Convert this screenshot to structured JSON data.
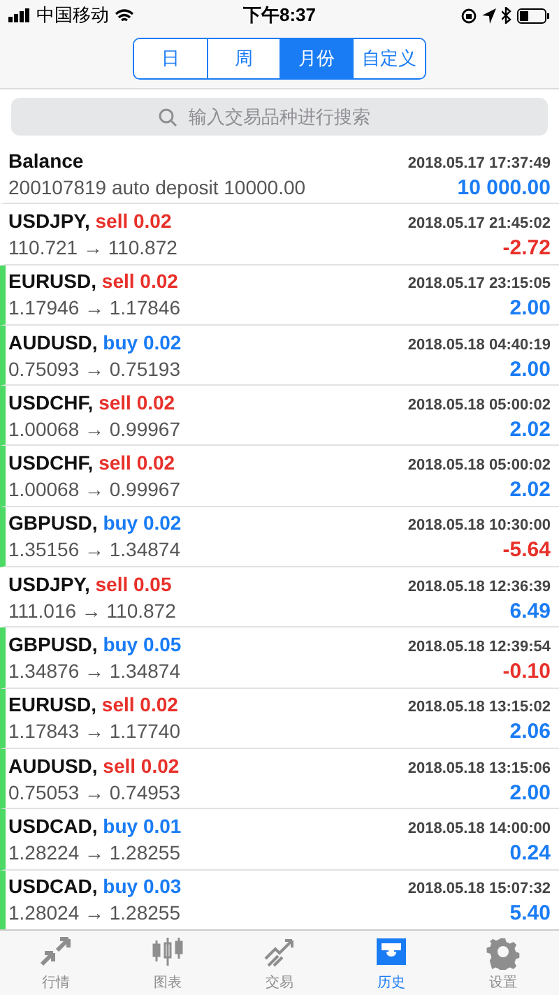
{
  "status_bar": {
    "carrier": "中国移动",
    "time": "下午8:37"
  },
  "period_tabs": [
    {
      "label": "日",
      "selected": false
    },
    {
      "label": "周",
      "selected": false
    },
    {
      "label": "月份",
      "selected": true
    },
    {
      "label": "自定义",
      "selected": false
    }
  ],
  "search": {
    "placeholder": "输入交易品种进行搜索"
  },
  "balance": {
    "title": "Balance",
    "time": "2018.05.17 17:37:49",
    "comment": "200107819 auto deposit 10000.00",
    "amount": "10 000.00"
  },
  "deals": [
    {
      "symbol": "USDJPY,",
      "side": "sell",
      "volume": "0.02",
      "time": "2018.05.17 21:45:02",
      "prices": "110.721 → 110.872",
      "profit": "-2.72",
      "loss": true,
      "marked": false
    },
    {
      "symbol": "EURUSD,",
      "side": "sell",
      "volume": "0.02",
      "time": "2018.05.17 23:15:05",
      "prices": "1.17946 → 1.17846",
      "profit": "2.00",
      "loss": false,
      "marked": true
    },
    {
      "symbol": "AUDUSD,",
      "side": "buy",
      "volume": "0.02",
      "time": "2018.05.18 04:40:19",
      "prices": "0.75093 → 0.75193",
      "profit": "2.00",
      "loss": false,
      "marked": true
    },
    {
      "symbol": "USDCHF,",
      "side": "sell",
      "volume": "0.02",
      "time": "2018.05.18 05:00:02",
      "prices": "1.00068 → 0.99967",
      "profit": "2.02",
      "loss": false,
      "marked": true
    },
    {
      "symbol": "USDCHF,",
      "side": "sell",
      "volume": "0.02",
      "time": "2018.05.18 05:00:02",
      "prices": "1.00068 → 0.99967",
      "profit": "2.02",
      "loss": false,
      "marked": true
    },
    {
      "symbol": "GBPUSD,",
      "side": "buy",
      "volume": "0.02",
      "time": "2018.05.18 10:30:00",
      "prices": "1.35156 → 1.34874",
      "profit": "-5.64",
      "loss": true,
      "marked": true
    },
    {
      "symbol": "USDJPY,",
      "side": "sell",
      "volume": "0.05",
      "time": "2018.05.18 12:36:39",
      "prices": "111.016 → 110.872",
      "profit": "6.49",
      "loss": false,
      "marked": false
    },
    {
      "symbol": "GBPUSD,",
      "side": "buy",
      "volume": "0.05",
      "time": "2018.05.18 12:39:54",
      "prices": "1.34876 → 1.34874",
      "profit": "-0.10",
      "loss": true,
      "marked": true
    },
    {
      "symbol": "EURUSD,",
      "side": "sell",
      "volume": "0.02",
      "time": "2018.05.18 13:15:02",
      "prices": "1.17843 → 1.17740",
      "profit": "2.06",
      "loss": false,
      "marked": true
    },
    {
      "symbol": "AUDUSD,",
      "side": "sell",
      "volume": "0.02",
      "time": "2018.05.18 13:15:06",
      "prices": "0.75053 → 0.74953",
      "profit": "2.00",
      "loss": false,
      "marked": true
    },
    {
      "symbol": "USDCAD,",
      "side": "buy",
      "volume": "0.01",
      "time": "2018.05.18 14:00:00",
      "prices": "1.28224 → 1.28255",
      "profit": "0.24",
      "loss": false,
      "marked": true
    },
    {
      "symbol": "USDCAD,",
      "side": "buy",
      "volume": "0.03",
      "time": "2018.05.18 15:07:32",
      "prices": "1.28024 → 1.28255",
      "profit": "5.40",
      "loss": false,
      "marked": true
    }
  ],
  "bottom_tabs": [
    {
      "label": "行情",
      "selected": false
    },
    {
      "label": "图表",
      "selected": false
    },
    {
      "label": "交易",
      "selected": false
    },
    {
      "label": "历史",
      "selected": true
    },
    {
      "label": "设置",
      "selected": false
    }
  ]
}
